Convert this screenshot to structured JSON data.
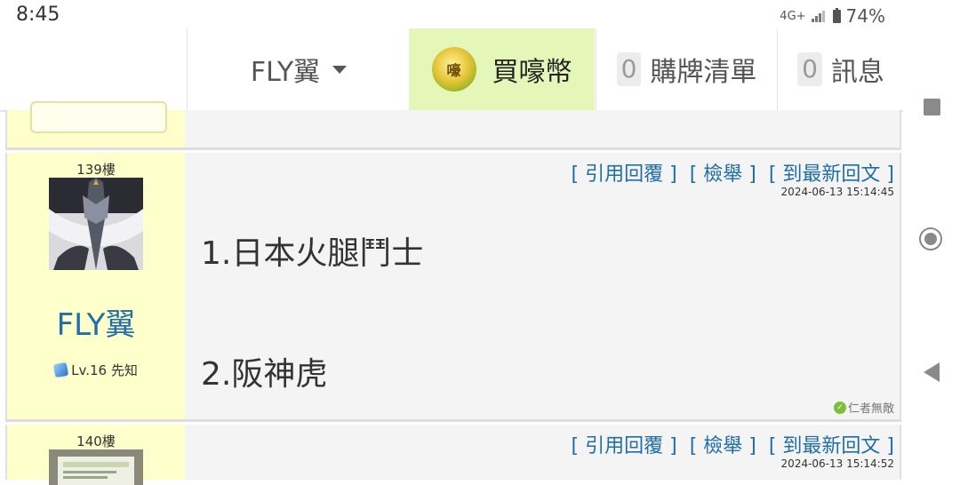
{
  "status_bar": {
    "time": "8:45",
    "network": "4G+",
    "battery": "74%"
  },
  "topbar": {
    "username": "FLY翼",
    "coin_label": "買嚎幣",
    "coin_icon_text": "嚎",
    "cart_count": "0",
    "cart_label": "購牌清單",
    "msg_count": "0",
    "msg_label": "訊息"
  },
  "posts": [
    {
      "floor": "139樓",
      "username": "FLY翼",
      "level": "Lv.16 先知",
      "actions": [
        "[ 引用回覆 ]",
        "[ 檢舉 ]",
        "[ 到最新回文 ]"
      ],
      "timestamp": "2024-06-13 15:14:45",
      "body": [
        "1.日本火腿鬥士",
        "2.阪神虎"
      ],
      "signature": "仁者無敵"
    },
    {
      "floor": "140樓",
      "actions": [
        "[ 引用回覆 ]",
        "[ 檢舉 ]",
        "[ 到最新回文 ]"
      ],
      "timestamp": "2024-06-13 15:14:52"
    }
  ],
  "colors": {
    "sidebar_bg": "#ffffcc",
    "link": "#1f6ea8",
    "coin_bg": "#e4f6b8"
  }
}
